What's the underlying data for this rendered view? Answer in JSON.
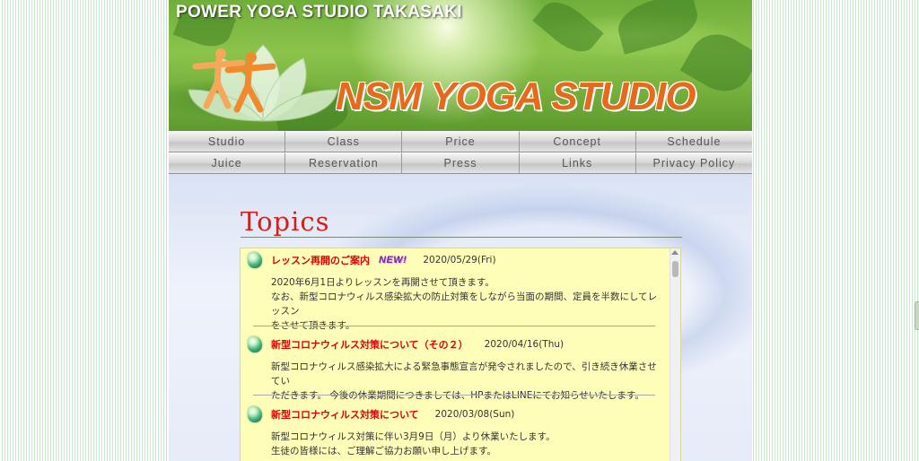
{
  "header": {
    "top_title": "POWER YOGA STUDIO TAKASAKI",
    "brand": "NSM YOGA STUDIO",
    "brand_color": "#e66a1e"
  },
  "nav": {
    "row1": [
      "Studio",
      "Class",
      "Price",
      "Concept",
      "Schedule"
    ],
    "row2": [
      "Juice",
      "Reservation",
      "Press",
      "Links",
      "Privacy Policy"
    ]
  },
  "topics": {
    "title": "Topics",
    "title_color": "#d21f1f",
    "entries": [
      {
        "title": "レッスン再開のご案内",
        "badge": "NEW!",
        "date": "2020/05/29(Fri)",
        "lines": [
          "2020年6月1日よりレッスンを再開させて頂きます。",
          "なお、新型コロナウィルス感染拡大の防止対策をしながら当面の期間、定員を半数にしてレッスン",
          "をさせて頂きます。"
        ]
      },
      {
        "title": "新型コロナウィルス対策について（その２）",
        "date": "2020/04/16(Thu)",
        "lines": [
          "新型コロナウィルス感染拡大による緊急事態宣言が発令されましたので、引き続き休業させてい",
          "ただきます。 今後の休業期間につきましては、HPまたはLINEにてお知らせいたします。"
        ]
      },
      {
        "title": "新型コロナウィルス対策について",
        "date": "2020/03/08(Sun)",
        "lines": [
          "新型コロナウィルス対策に伴い3月9日（月）より休業いたします。",
          "生徒の皆様には、ご理解ご協力お願い申し上げます。"
        ]
      }
    ]
  },
  "colors": {
    "news_background": "#fffeb9",
    "entry_title": "#e00000",
    "badge": "#6a22a8"
  },
  "icons": [
    "gem-bullet-icon"
  ]
}
